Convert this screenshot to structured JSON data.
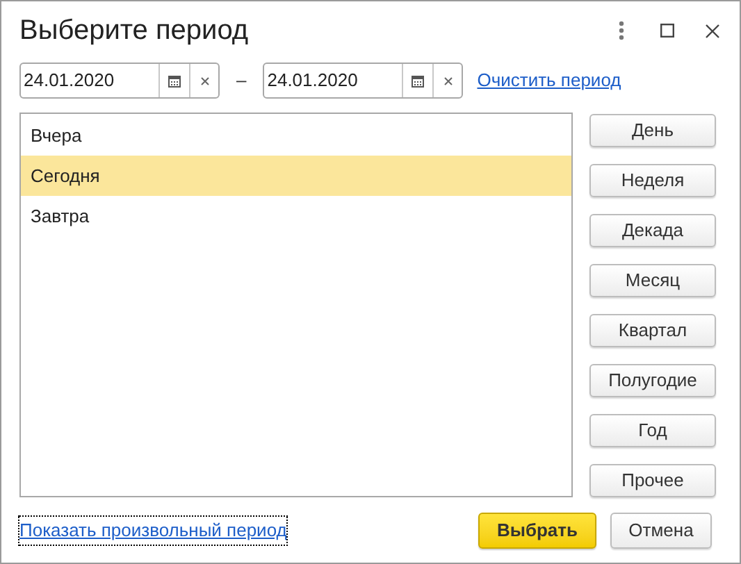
{
  "window": {
    "title": "Выберите период"
  },
  "period": {
    "start": "24.01.2020",
    "separator": "–",
    "end": "24.01.2020",
    "clear_link": "Очистить период"
  },
  "list": [
    {
      "label": "Вчера",
      "selected": false
    },
    {
      "label": "Сегодня",
      "selected": true
    },
    {
      "label": "Завтра",
      "selected": false
    }
  ],
  "period_buttons": [
    "День",
    "Неделя",
    "Декада",
    "Месяц",
    "Квартал",
    "Полугодие",
    "Год",
    "Прочее"
  ],
  "custom_link": "Показать произвольный период",
  "buttons": [
    {
      "label": "Выбрать",
      "kind": "primary"
    },
    {
      "label": "Отмена",
      "kind": "default"
    }
  ]
}
